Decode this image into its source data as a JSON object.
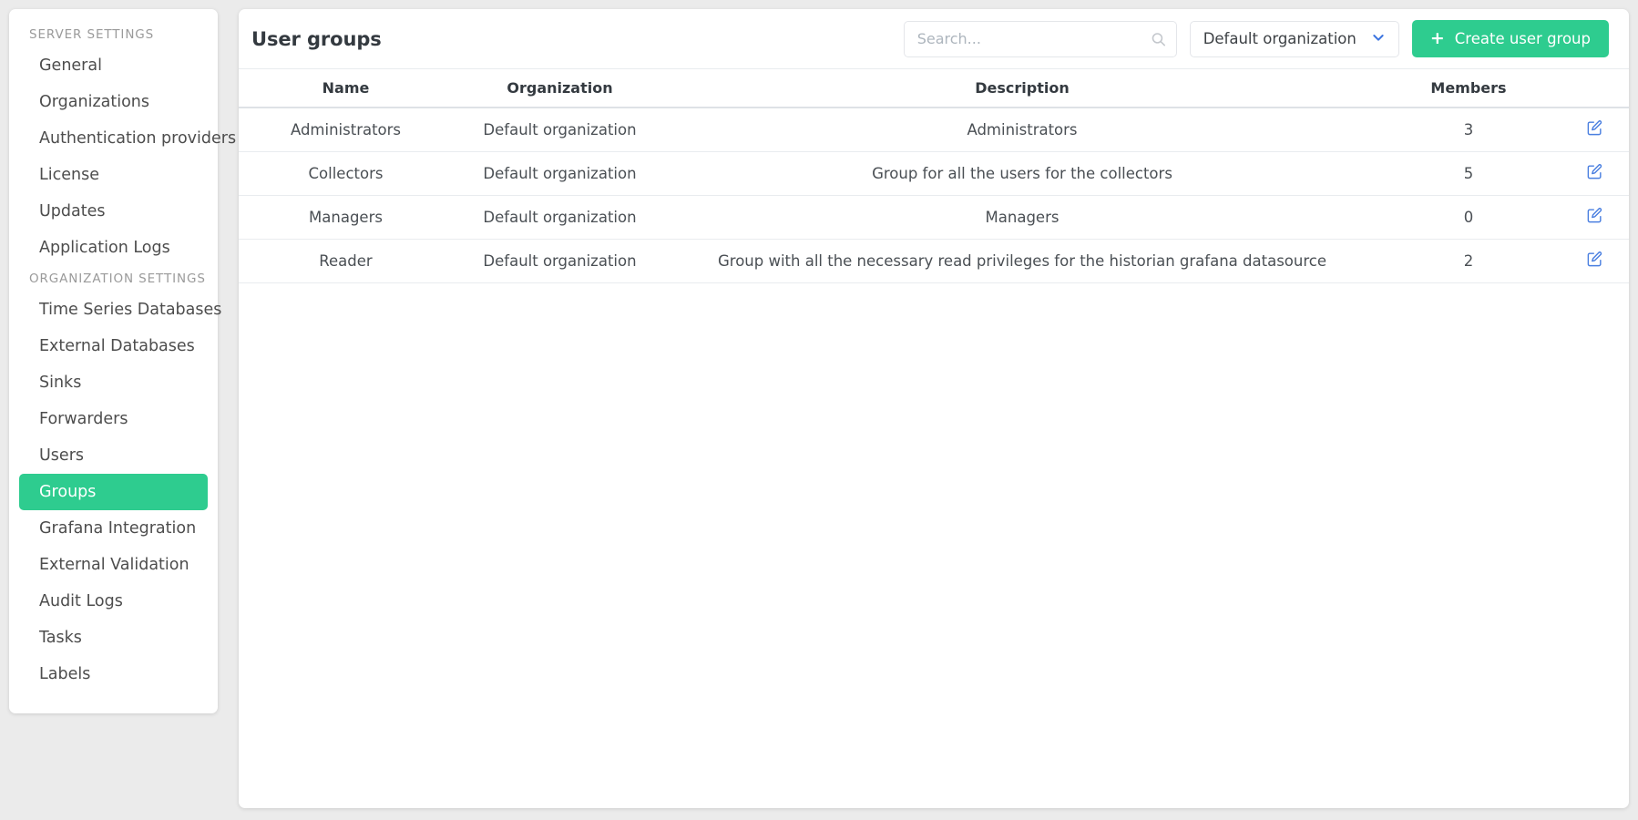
{
  "sidebar": {
    "sections": [
      {
        "title": "SERVER SETTINGS",
        "items": [
          {
            "label": "General",
            "active": false
          },
          {
            "label": "Organizations",
            "active": false
          },
          {
            "label": "Authentication providers",
            "active": false
          },
          {
            "label": "License",
            "active": false
          },
          {
            "label": "Updates",
            "active": false
          },
          {
            "label": "Application Logs",
            "active": false
          }
        ]
      },
      {
        "title": "ORGANIZATION SETTINGS",
        "items": [
          {
            "label": "Time Series Databases",
            "active": false
          },
          {
            "label": "External Databases",
            "active": false
          },
          {
            "label": "Sinks",
            "active": false
          },
          {
            "label": "Forwarders",
            "active": false
          },
          {
            "label": "Users",
            "active": false
          },
          {
            "label": "Groups",
            "active": true
          },
          {
            "label": "Grafana Integration",
            "active": false
          },
          {
            "label": "External Validation",
            "active": false
          },
          {
            "label": "Audit Logs",
            "active": false
          },
          {
            "label": "Tasks",
            "active": false
          },
          {
            "label": "Labels",
            "active": false
          }
        ]
      }
    ]
  },
  "header": {
    "title": "User groups",
    "search": {
      "value": "",
      "placeholder": "Search...",
      "icon": "search-icon"
    },
    "org_select": {
      "selected": "Default organization",
      "icon": "chevron-down-icon"
    },
    "create_button": {
      "label": "Create user group",
      "icon": "plus-icon"
    }
  },
  "table": {
    "columns": [
      "Name",
      "Organization",
      "Description",
      "Members",
      ""
    ],
    "rows": [
      {
        "name": "Administrators",
        "organization": "Default organization",
        "description": "Administrators",
        "members": "3",
        "action_icon": "edit-icon"
      },
      {
        "name": "Collectors",
        "organization": "Default organization",
        "description": "Group for all the users for the collectors",
        "members": "5",
        "action_icon": "edit-icon"
      },
      {
        "name": "Managers",
        "organization": "Default organization",
        "description": "Managers",
        "members": "0",
        "action_icon": "edit-icon"
      },
      {
        "name": "Reader",
        "organization": "Default organization",
        "description": "Group with all the necessary read privileges for the historian grafana datasource",
        "members": "2",
        "action_icon": "edit-icon"
      }
    ]
  },
  "colors": {
    "accent_green": "#2ecc8f",
    "edit_blue": "#4a7fe0",
    "chevron_blue": "#3b74e0",
    "page_background": "#ebebeb",
    "card_background": "#ffffff",
    "text_primary": "#343a40",
    "text_muted": "#9a9a9a"
  }
}
